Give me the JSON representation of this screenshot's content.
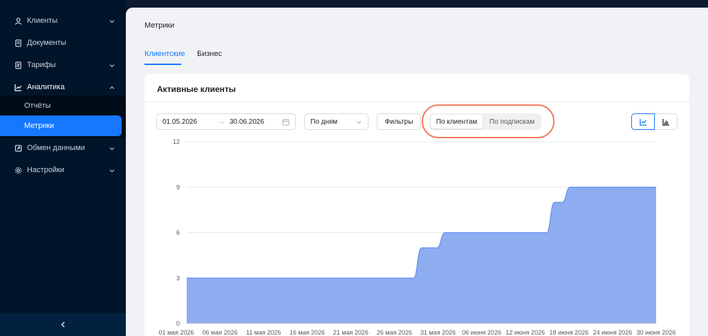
{
  "sidebar": {
    "items": [
      {
        "label": "Клиенты",
        "icon": "user-icon"
      },
      {
        "label": "Документы",
        "icon": "document-icon"
      },
      {
        "label": "Тарифы",
        "icon": "tariff-icon"
      },
      {
        "label": "Аналитика",
        "icon": "chart-line-icon"
      },
      {
        "label": "Обмен данными",
        "icon": "exchange-icon"
      },
      {
        "label": "Настройки",
        "icon": "gear-icon"
      }
    ],
    "analytics_sub": [
      {
        "label": "Отчёты"
      },
      {
        "label": "Метрики"
      }
    ],
    "collapse_icon": "chevron-left-icon"
  },
  "page": {
    "title": "Метрики",
    "tabs": [
      {
        "label": "Клиентские"
      },
      {
        "label": "Бизнес"
      }
    ]
  },
  "card": {
    "title": "Активные клиенты",
    "range_start": "01.05.2026",
    "range_arrow": "→",
    "range_end": "30.06.2026",
    "granularity": "По дням",
    "filters_label": "Фильтры",
    "segments": [
      {
        "label": "По клиентам"
      },
      {
        "label": "По подпискам"
      }
    ],
    "view_icons": [
      "line-chart-icon",
      "bar-chart-icon"
    ]
  },
  "colors": {
    "accent": "#1677ff",
    "sidebar_bg": "#001529",
    "area_fill": "#8eacf0",
    "area_stroke": "#5b8ff9",
    "highlight": "#f27c5c"
  },
  "chart_data": {
    "type": "area",
    "title": "",
    "xlabel": "",
    "ylabel": "",
    "ylim": [
      0,
      12
    ],
    "yticks": [
      0,
      3,
      6,
      9,
      12
    ],
    "grid": true,
    "x_tick_labels": [
      "01 мая 2026",
      "06 мая 2026",
      "11 мая 2026",
      "16 мая 2026",
      "21 мая 2026",
      "26 мая 2026",
      "31 мая 2026",
      "06 июня 2026",
      "12 июня 2026",
      "18 июня 2026",
      "24 июня 2026",
      "30 июня 2026"
    ],
    "series": [
      {
        "x": [
          "01.05.2026",
          "30.05.2026",
          "31.05.2026",
          "02.06.2026",
          "03.06.2026",
          "12.06.2026",
          "13.06.2026",
          "16.06.2026",
          "17.06.2026",
          "18.06.2026",
          "19.06.2026",
          "30.06.2026"
        ],
        "values": [
          3,
          3,
          5,
          5,
          6,
          6,
          6,
          6,
          8,
          8,
          9,
          9
        ]
      }
    ]
  }
}
